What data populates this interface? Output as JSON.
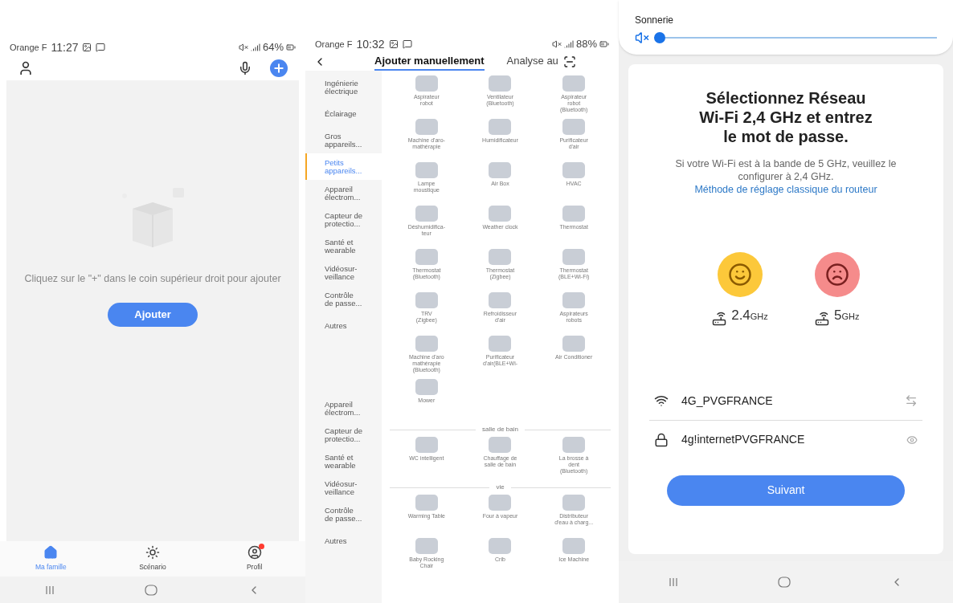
{
  "home_screen": {
    "status_bar": {
      "carrier": "Orange F",
      "time": "11:27",
      "battery": "64%"
    },
    "empty_message": "Cliquez sur le \"+\" dans le coin supérieur droit pour ajouter",
    "add_button": "Ajouter",
    "bottom_nav": [
      {
        "label": "Ma famille",
        "kind": "home",
        "selected": true,
        "badge": false
      },
      {
        "label": "Scénario",
        "kind": "scene",
        "selected": false,
        "badge": false
      },
      {
        "label": "Profil",
        "kind": "profile",
        "selected": false,
        "badge": true
      }
    ]
  },
  "add_device_screen": {
    "status_bar": {
      "carrier": "Orange F",
      "time": "10:32",
      "battery": "88%"
    },
    "tabs": [
      {
        "label": "Ajouter manuellement",
        "selected": true
      },
      {
        "label": "Analyse au",
        "selected": false
      }
    ],
    "sidebar_groups": [
      [
        {
          "label": "Ingénierie\nélectrique",
          "selected": false
        },
        {
          "label": "Éclairage",
          "selected": false
        },
        {
          "label": "Gros\nappareils...",
          "selected": false
        },
        {
          "label": "Petits\nappareils...",
          "selected": true
        },
        {
          "label": "Appareil\nélectrom...",
          "selected": false
        },
        {
          "label": "Capteur de\nprotectio...",
          "selected": false
        },
        {
          "label": "Santé et\nwearable",
          "selected": false
        },
        {
          "label": "Vidéosur-\nveillance",
          "selected": false
        },
        {
          "label": "Contrôle\nde passe...",
          "selected": false
        },
        {
          "label": "Autres",
          "selected": false
        }
      ],
      [
        {
          "label": "Appareil\nélectrom...",
          "selected": false
        },
        {
          "label": "Capteur de\nprotectio...",
          "selected": false
        },
        {
          "label": "Santé et\nwearable",
          "selected": false
        },
        {
          "label": "Vidéosur-\nveillance",
          "selected": false
        },
        {
          "label": "Contrôle\nde passe...",
          "selected": false
        },
        {
          "label": "Autres",
          "selected": false
        }
      ]
    ],
    "sections": [
      {
        "items": [
          "Aspirateur\nrobot",
          "Ventilateur\n(Bluetooth)",
          "Aspirateur\nrobot\n(Bluetooth)",
          "Machine d'aro-\nmathérapie",
          "Humidificateur",
          "Purificateur\nd'air",
          "Lampe\nmoustique",
          "Air Box",
          "HVAC",
          "Déshumidifica-\nteur",
          "Weather clock",
          "Thermostat",
          "Thermostat\n(Bluetooth)",
          "Thermostat\n(Zigbee)",
          "Thermostat\n(BLE+Wi-Fi)",
          "TRV\n(Zigbee)",
          "Refroidisseur\nd'air",
          "Aspirateurs\nrobots",
          "Machine d'aro\nmathérapie\n(Bluetooth)",
          "Purificateur\nd'air(BLE+Wi-",
          "Air Conditioner",
          "Mower"
        ]
      },
      {
        "title": "salle de bain",
        "items": [
          "WC intelligent",
          "Chauffage de\nsalle de bain",
          "La brosse à\ndent\n(Bluetooth)"
        ]
      },
      {
        "title": "vie",
        "items": [
          "Warming Table",
          "Four à vapeur",
          "Distributeur\nd'eau à charg...",
          "Baby Rocking\nChair",
          "Crib",
          "Ice Machine"
        ]
      }
    ]
  },
  "wifi_screen": {
    "volume_panel": {
      "label": "Sonnerie",
      "muted": true,
      "level": 0.0
    },
    "title": "Sélectionnez Réseau\nWi-Fi 2,4 GHz et entrez\nle mot de passe.",
    "description": "Si votre Wi-Fi est à  la bande de 5 GHz, veuillez le configurer à 2,4 GHz.",
    "link": "Méthode de réglage classique du routeur",
    "bands": [
      {
        "value": "2.4",
        "unit": "GHz",
        "kind": "ok"
      },
      {
        "value": "5",
        "unit": "GHz",
        "kind": "bad"
      }
    ],
    "network": "4G_PVGFRANCE",
    "password": "4g!internetPVGFRANCE",
    "next_button": "Suivant"
  }
}
